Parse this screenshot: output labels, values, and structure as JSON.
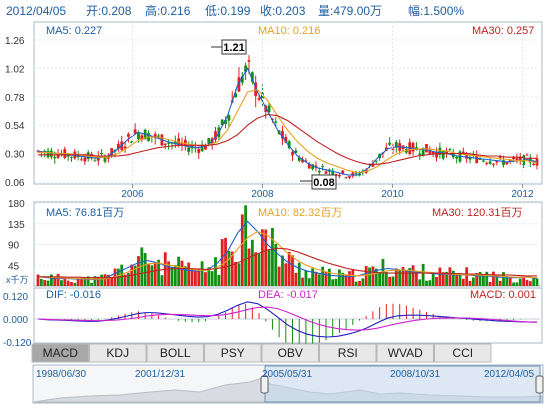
{
  "header": {
    "date": "2012/04/05",
    "open": "开:0.208",
    "high": "高:0.216",
    "low": "低:0.199",
    "close": "收:0.203",
    "volume": "量:479.00万",
    "amplitude": "幅:1.500%"
  },
  "price_panel": {
    "ma5": "MA5: 0.227",
    "ma10": "MA10: 0.216",
    "ma30": "MA30: 0.257",
    "y_ticks": [
      "1.26",
      "1.02",
      "0.78",
      "0.54",
      "0.30",
      "0.06"
    ],
    "max_label": "1.21",
    "min_label": "0.08"
  },
  "volume_panel": {
    "ma5": "MA5: 76.81百万",
    "ma10": "MA10: 82.32百万",
    "ma30": "MA30: 120.31百万",
    "y_ticks": [
      "180",
      "135",
      "90",
      "45"
    ],
    "unit": "x千万"
  },
  "macd_panel": {
    "dif": "DIF: -0.016",
    "dea": "DEA: -0.017",
    "macd": "MACD: 0.001",
    "y_ticks": [
      "0.120",
      "0.000",
      "-0.120"
    ]
  },
  "x_ticks": [
    "2006",
    "2008",
    "2010",
    "2012"
  ],
  "tabs": [
    "MACD",
    "KDJ",
    "BOLL",
    "PSY",
    "OBV",
    "RSI",
    "WVAD",
    "CCI"
  ],
  "active_tab": "MACD",
  "navigator": {
    "labels": [
      "1998/06/30",
      "2001/12/31",
      "2005/05/31",
      "2008/10/31",
      "2012/04/05"
    ]
  },
  "colors": {
    "up": "#e02020",
    "down": "#109010",
    "ma5": "#2060d0",
    "ma10": "#e8a020",
    "ma30": "#c02020",
    "dif": "#2020c0",
    "dea": "#d020d0",
    "panel_border": "#a8b8c8",
    "label_blue": "#2060a0",
    "tab_bg": "#e8e8e8",
    "tab_active": "#a8a8a8"
  },
  "chart_data": [
    {
      "type": "candlestick",
      "title": "",
      "x_range": [
        "2004-06",
        "2012-04"
      ],
      "ylim": [
        0.06,
        1.26
      ],
      "x_ticks": [
        "2006",
        "2008",
        "2010",
        "2012"
      ],
      "y_ticks": [
        1.26,
        1.02,
        0.78,
        0.54,
        0.3,
        0.06
      ],
      "series": [
        {
          "name": "MA5",
          "values": [
            0.32,
            0.31,
            0.3,
            0.29,
            0.28,
            0.27,
            0.26,
            0.28,
            0.34,
            0.42,
            0.48,
            0.46,
            0.43,
            0.4,
            0.38,
            0.36,
            0.35,
            0.37,
            0.46,
            0.62,
            0.88,
            1.02,
            0.82,
            0.66,
            0.5,
            0.38,
            0.28,
            0.22,
            0.18,
            0.16,
            0.14,
            0.12,
            0.12,
            0.17,
            0.26,
            0.34,
            0.36,
            0.35,
            0.34,
            0.33,
            0.31,
            0.3,
            0.28,
            0.27,
            0.26,
            0.25,
            0.24,
            0.23,
            0.24,
            0.25,
            0.23
          ]
        },
        {
          "name": "MA10",
          "values": [
            0.31,
            0.31,
            0.3,
            0.3,
            0.29,
            0.28,
            0.27,
            0.27,
            0.3,
            0.35,
            0.41,
            0.44,
            0.44,
            0.42,
            0.4,
            0.38,
            0.37,
            0.37,
            0.4,
            0.5,
            0.66,
            0.82,
            0.84,
            0.75,
            0.62,
            0.5,
            0.4,
            0.32,
            0.26,
            0.22,
            0.19,
            0.16,
            0.14,
            0.15,
            0.19,
            0.25,
            0.3,
            0.33,
            0.34,
            0.34,
            0.33,
            0.32,
            0.3,
            0.29,
            0.28,
            0.27,
            0.26,
            0.25,
            0.24,
            0.24,
            0.22
          ]
        },
        {
          "name": "MA30",
          "values": [
            0.29,
            0.29,
            0.29,
            0.29,
            0.29,
            0.29,
            0.28,
            0.28,
            0.28,
            0.29,
            0.31,
            0.33,
            0.35,
            0.36,
            0.37,
            0.37,
            0.37,
            0.37,
            0.38,
            0.41,
            0.46,
            0.54,
            0.6,
            0.63,
            0.62,
            0.58,
            0.52,
            0.46,
            0.4,
            0.35,
            0.3,
            0.26,
            0.23,
            0.21,
            0.21,
            0.22,
            0.24,
            0.26,
            0.28,
            0.29,
            0.3,
            0.3,
            0.3,
            0.3,
            0.29,
            0.28,
            0.28,
            0.27,
            0.27,
            0.26,
            0.26
          ]
        }
      ],
      "annotations": {
        "high": 1.21,
        "low": 0.08
      }
    },
    {
      "type": "bar",
      "title": "",
      "ylabel": "x千万",
      "ylim": [
        0,
        180
      ],
      "y_ticks": [
        180,
        135,
        90,
        45
      ],
      "series": [
        {
          "name": "MA5",
          "values": [
            20,
            18,
            16,
            16,
            15,
            14,
            14,
            20,
            30,
            40,
            50,
            55,
            50,
            42,
            38,
            34,
            32,
            35,
            50,
            75,
            115,
            140,
            118,
            90,
            70,
            52,
            40,
            32,
            28,
            24,
            22,
            20,
            22,
            28,
            34,
            38,
            36,
            32,
            30,
            28,
            26,
            25,
            24,
            24,
            22,
            22,
            20,
            18,
            18,
            20,
            16
          ]
        },
        {
          "name": "MA10",
          "values": [
            20,
            19,
            18,
            17,
            16,
            15,
            15,
            16,
            22,
            30,
            40,
            48,
            50,
            46,
            42,
            38,
            34,
            34,
            40,
            55,
            80,
            105,
            118,
            110,
            92,
            72,
            55,
            44,
            36,
            30,
            26,
            24,
            22,
            24,
            28,
            33,
            35,
            34,
            32,
            30,
            28,
            26,
            25,
            24,
            24,
            23,
            22,
            20,
            19,
            19,
            18
          ]
        },
        {
          "name": "MA30",
          "values": [
            20,
            20,
            20,
            19,
            19,
            18,
            18,
            18,
            19,
            22,
            26,
            30,
            34,
            37,
            38,
            38,
            37,
            36,
            38,
            42,
            50,
            60,
            70,
            78,
            82,
            80,
            74,
            66,
            58,
            50,
            44,
            38,
            34,
            31,
            29,
            28,
            28,
            28,
            28,
            28,
            28,
            27,
            27,
            26,
            26,
            25,
            24,
            24,
            23,
            22,
            22
          ]
        }
      ]
    },
    {
      "type": "line",
      "title": "MACD",
      "ylim": [
        -0.12,
        0.12
      ],
      "y_ticks": [
        0.12,
        0.0,
        -0.12
      ],
      "series": [
        {
          "name": "DIF",
          "values": [
            0.0,
            -0.004,
            -0.006,
            -0.008,
            -0.01,
            -0.012,
            -0.012,
            -0.006,
            0.004,
            0.016,
            0.028,
            0.034,
            0.032,
            0.026,
            0.02,
            0.014,
            0.01,
            0.012,
            0.024,
            0.046,
            0.072,
            0.09,
            0.08,
            0.05,
            0.01,
            -0.03,
            -0.06,
            -0.08,
            -0.09,
            -0.094,
            -0.09,
            -0.08,
            -0.066,
            -0.046,
            -0.02,
            0.004,
            0.016,
            0.02,
            0.02,
            0.018,
            0.014,
            0.01,
            0.006,
            0.002,
            -0.002,
            -0.006,
            -0.01,
            -0.012,
            -0.014,
            -0.015,
            -0.016
          ]
        },
        {
          "name": "DEA",
          "values": [
            0.0,
            -0.002,
            -0.004,
            -0.005,
            -0.007,
            -0.008,
            -0.009,
            -0.008,
            -0.005,
            0.0,
            0.008,
            0.016,
            0.022,
            0.024,
            0.024,
            0.022,
            0.019,
            0.017,
            0.018,
            0.025,
            0.036,
            0.05,
            0.06,
            0.062,
            0.054,
            0.036,
            0.014,
            -0.008,
            -0.026,
            -0.04,
            -0.05,
            -0.056,
            -0.058,
            -0.056,
            -0.048,
            -0.036,
            -0.024,
            -0.014,
            -0.006,
            0.0,
            0.004,
            0.006,
            0.006,
            0.005,
            0.003,
            0.0,
            -0.004,
            -0.008,
            -0.012,
            -0.015,
            -0.017
          ]
        }
      ]
    }
  ]
}
